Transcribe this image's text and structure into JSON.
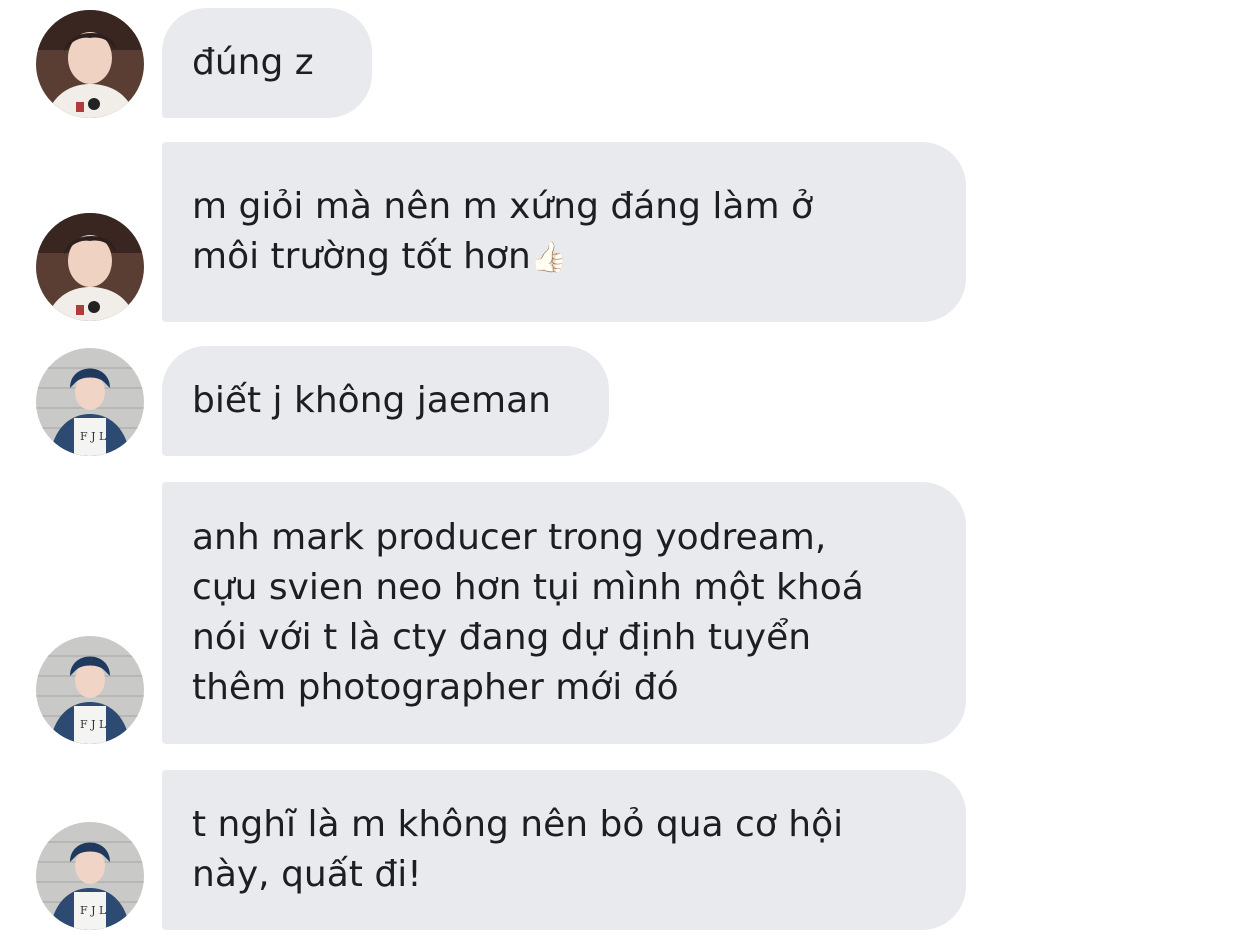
{
  "messages": [
    {
      "sender": "friend-a",
      "lines": [
        "đúng z"
      ]
    },
    {
      "sender": "friend-a",
      "lines": [
        "m giỏi mà nên m xứng đáng làm ở",
        "môi trường tốt hơn"
      ],
      "emoji": "👍🏻"
    },
    {
      "sender": "friend-b",
      "lines": [
        "biết j không jaeman"
      ]
    },
    {
      "sender": "friend-b",
      "lines": [
        "anh mark producer trong yodream,",
        "cựu svien neo hơn tụi mình một khoá",
        "nói với t là cty đang dự định tuyển",
        "thêm photographer mới đó"
      ]
    },
    {
      "sender": "friend-b",
      "lines": [
        "t nghĩ là m không nên bỏ qua cơ hội",
        "này, quất đi!"
      ]
    }
  ],
  "colors": {
    "bubble": "#e9eaee",
    "text": "#1c1e21",
    "background": "#ffffff"
  }
}
